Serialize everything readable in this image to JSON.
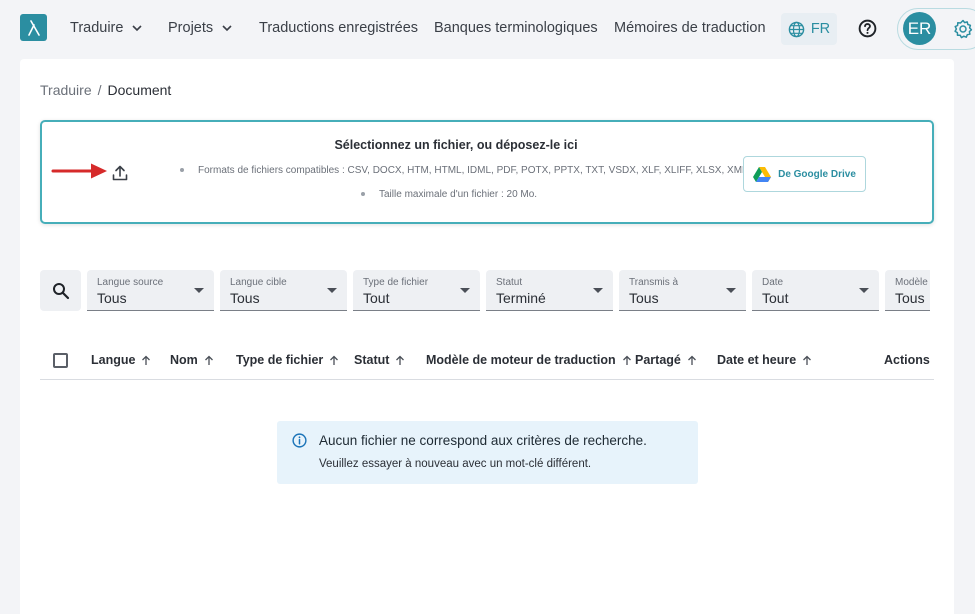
{
  "nav": {
    "items": [
      {
        "label": "Traduire",
        "has_dropdown": true
      },
      {
        "label": "Projets",
        "has_dropdown": true
      },
      {
        "label": "Traductions enregistrées",
        "has_dropdown": false
      },
      {
        "label": "Banques terminologiques",
        "has_dropdown": false
      },
      {
        "label": "Mémoires de traduction",
        "has_dropdown": false
      }
    ],
    "language": "FR",
    "avatar_initials": "ER"
  },
  "breadcrumb": {
    "parent": "Traduire",
    "separator": "/",
    "current": "Document"
  },
  "dropzone": {
    "title": "Sélectionnez un fichier, ou déposez-le ici",
    "formats": "Formats de fichiers compatibles : CSV, DOCX, HTM, HTML, IDML, PDF, POTX, PPTX, TXT, VSDX, XLF, XLIFF, XLSX, XML",
    "max_size": "Taille maximale d'un fichier : 20 Mo.",
    "gdrive_label": "De Google Drive"
  },
  "filters": [
    {
      "label": "Langue source",
      "value": "Tous"
    },
    {
      "label": "Langue cible",
      "value": "Tous"
    },
    {
      "label": "Type de fichier",
      "value": "Tout"
    },
    {
      "label": "Statut",
      "value": "Terminé"
    },
    {
      "label": "Transmis à",
      "value": "Tous"
    },
    {
      "label": "Date",
      "value": "Tout"
    },
    {
      "label": "Modèle",
      "value": "Tous"
    }
  ],
  "table": {
    "columns": [
      "Langue",
      "Nom",
      "Type de fichier",
      "Statut",
      "Modèle de moteur de traduction",
      "Partagé",
      "Date et heure",
      "Actions"
    ]
  },
  "empty_state": {
    "title": "Aucun fichier ne correspond aux critères de recherche.",
    "subtitle": "Veuillez essayer à nouveau avec un mot-clé différent."
  },
  "colors": {
    "accent": "#2b8ea1",
    "dropzone_border": "#46aeb9",
    "info_bg": "#e7f3fb",
    "annotation_arrow": "#d62a2a"
  }
}
